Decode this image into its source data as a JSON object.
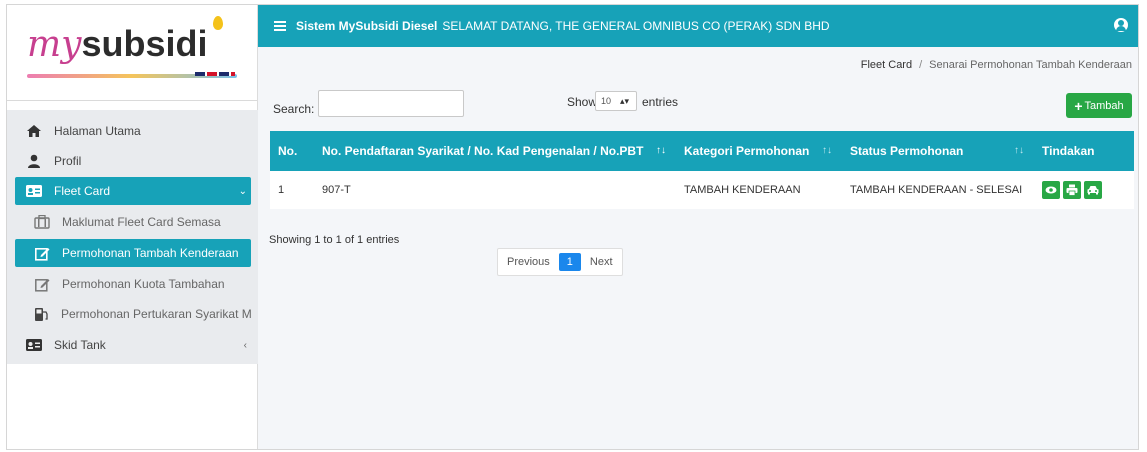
{
  "sidebar": {
    "logo": {
      "prefix": "my",
      "suffix": "subsidi"
    },
    "items": [
      {
        "label": "Halaman Utama",
        "icon": "home-icon"
      },
      {
        "label": "Profil",
        "icon": "user-icon"
      },
      {
        "label": "Fleet Card",
        "icon": "id-card-icon"
      },
      {
        "label": "Maklumat Fleet Card Semasa",
        "icon": "luggage-icon"
      },
      {
        "label": "Permohonan Tambah Kenderaan",
        "icon": "edit-icon"
      },
      {
        "label": "Permohonan Kuota Tambahan",
        "icon": "edit-icon"
      },
      {
        "label": "Permohonan Pertukaran Syarikat Minyak",
        "icon": "fuel-icon"
      },
      {
        "label": "Skid Tank",
        "icon": "id-card-icon"
      }
    ]
  },
  "header": {
    "system_name": "Sistem MySubsidi Diesel",
    "welcome": "SELAMAT DATANG, THE GENERAL OMNIBUS CO (PERAK) SDN BHD"
  },
  "breadcrumb": {
    "parent": "Fleet Card",
    "separator": "/",
    "current": "Senarai Permohonan Tambah Kenderaan"
  },
  "controls": {
    "search_label": "Search:",
    "show_label": "Show",
    "show_value": "10",
    "entries_label": "entries",
    "add_button": "Tambah"
  },
  "table": {
    "headers": [
      "No.",
      "No. Pendaftaran Syarikat / No. Kad Pengenalan / No.PBT",
      "Kategori Permohonan",
      "Status Permohonan",
      "Tindakan"
    ],
    "rows": [
      {
        "no": "1",
        "reg": "907-T",
        "kategori": "TAMBAH KENDERAAN",
        "status": "TAMBAH KENDERAAN - SELESAI"
      }
    ]
  },
  "footer": {
    "info": "Showing 1 to 1 of 1 entries",
    "prev": "Previous",
    "page": "1",
    "next": "Next"
  },
  "colors": {
    "primary": "#17a2b8",
    "success": "#28a745",
    "page_active": "#1a87ec"
  }
}
